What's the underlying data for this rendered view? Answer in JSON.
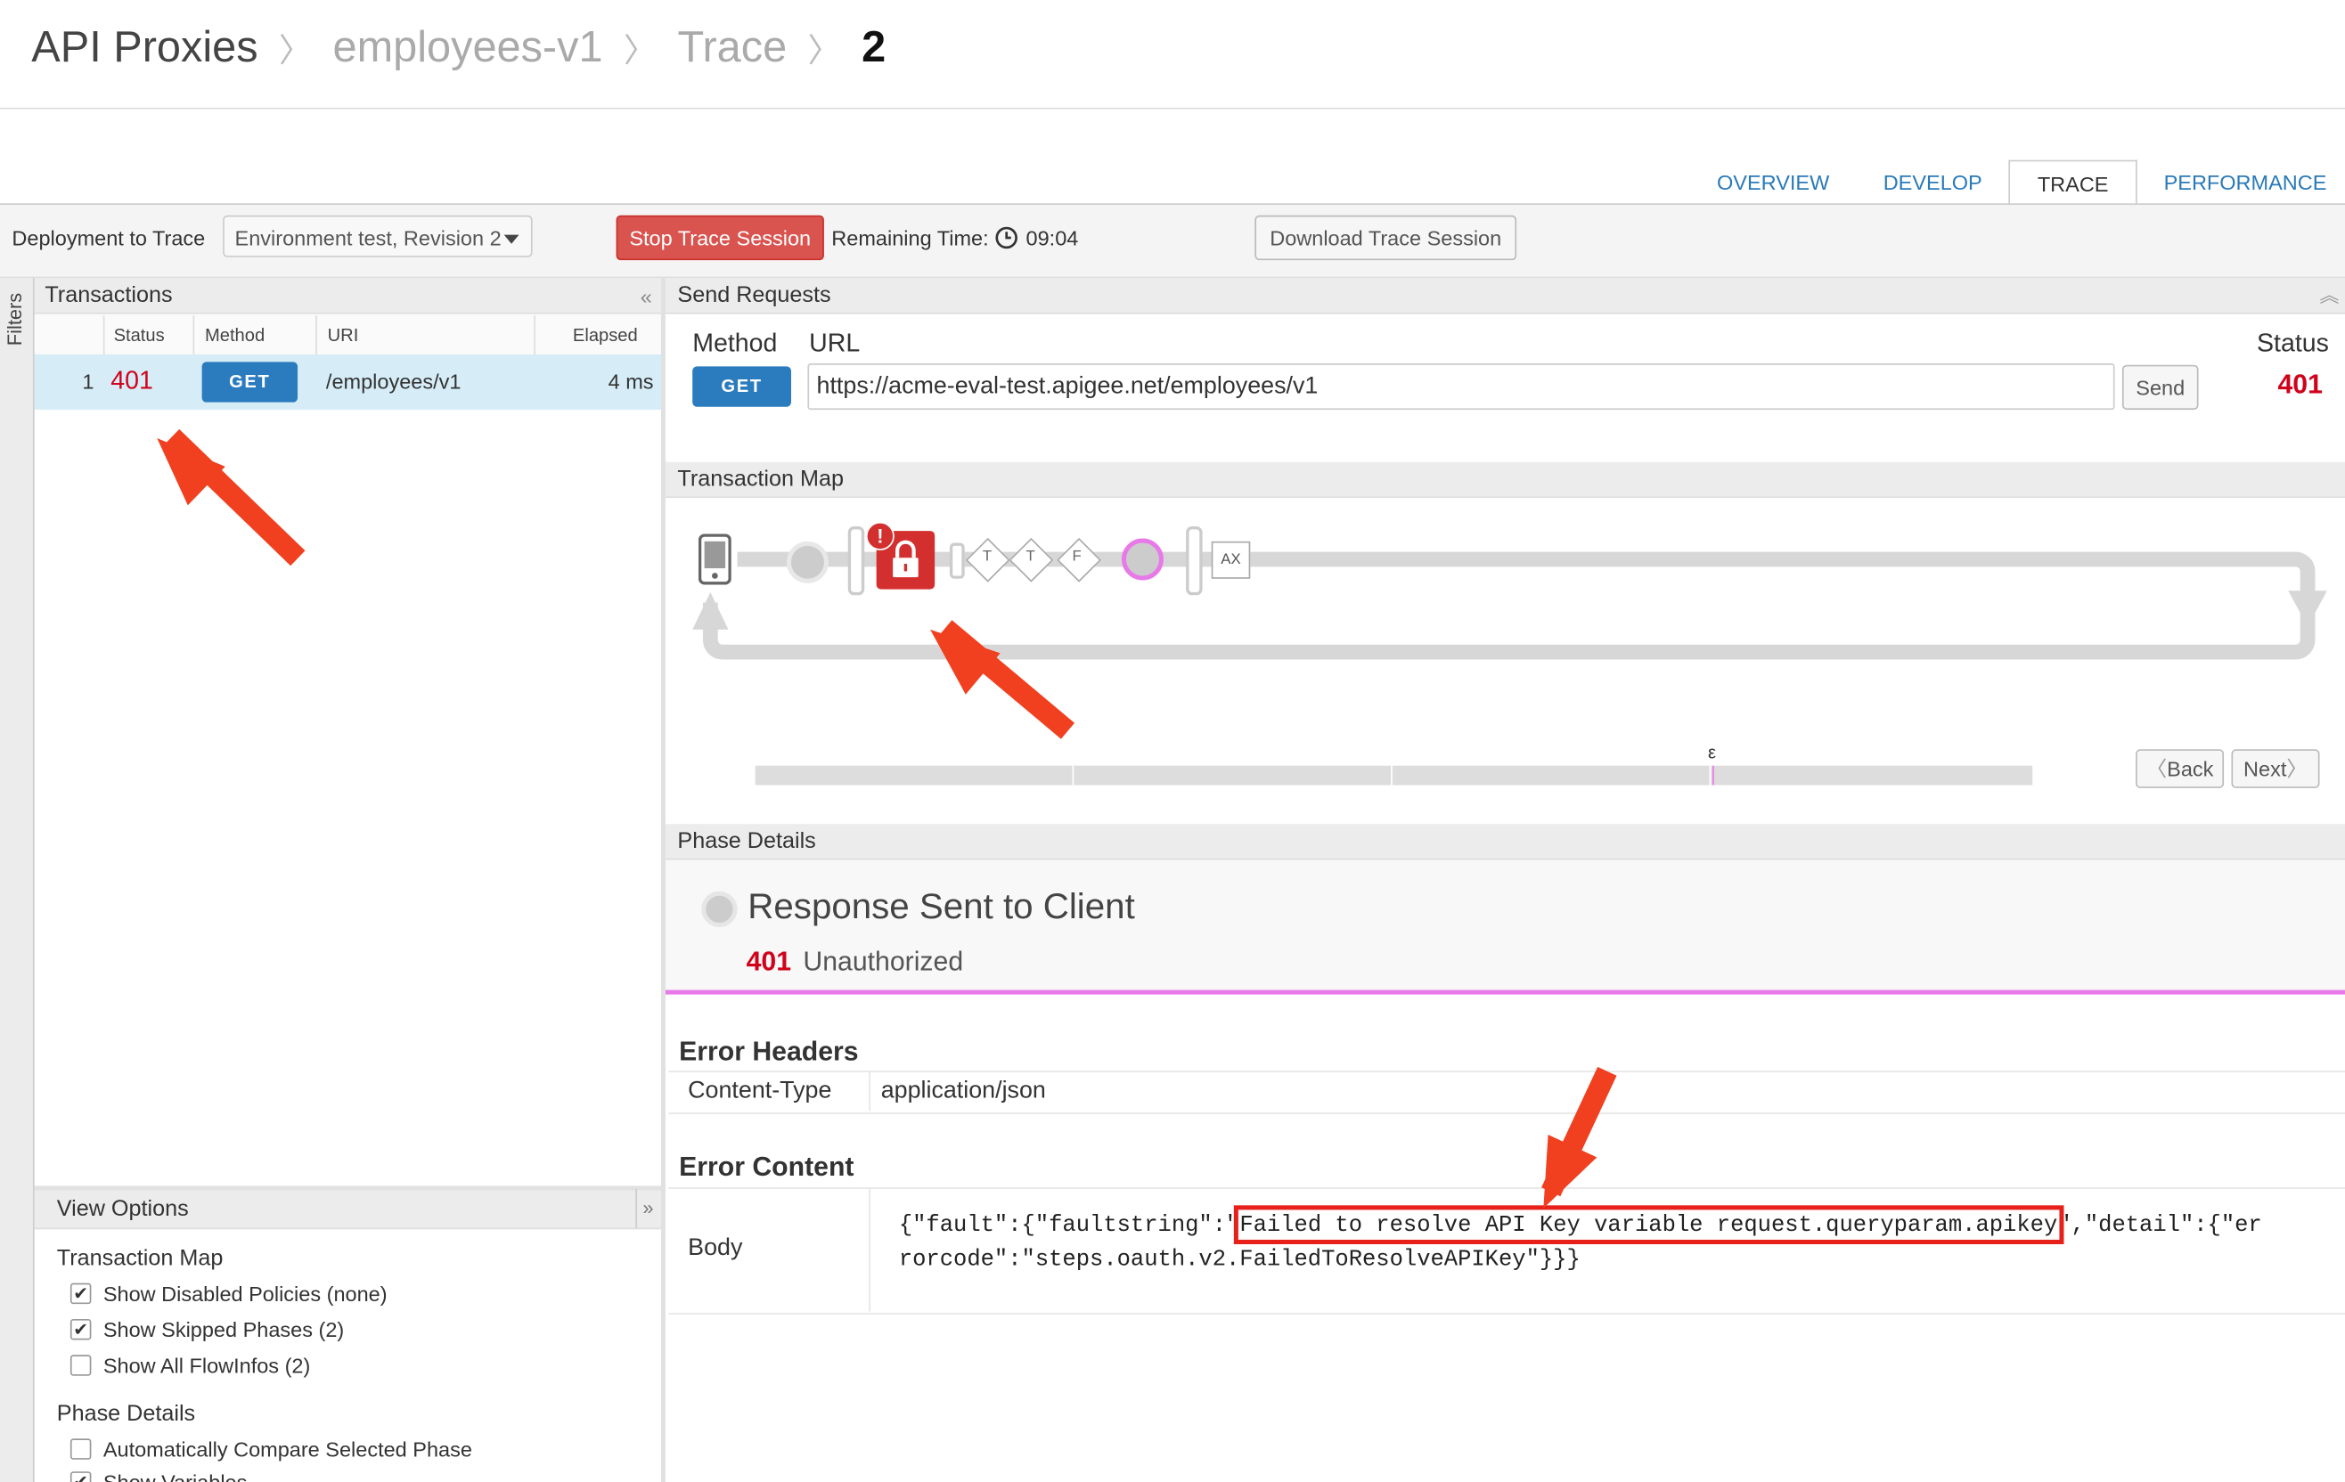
{
  "breadcrumb": {
    "items": [
      "API Proxies",
      "employees-v1",
      "Trace"
    ],
    "current": "2"
  },
  "tabs": [
    "OVERVIEW",
    "DEVELOP",
    "TRACE",
    "PERFORMANCE"
  ],
  "active_tab": "TRACE",
  "toolbar": {
    "deploy_label": "Deployment to Trace",
    "deploy_value": "Environment test, Revision 2",
    "stop_button": "Stop Trace Session",
    "remaining_label": "Remaining Time:",
    "remaining_value": "09:04",
    "download_button": "Download Trace Session"
  },
  "sidebar": {
    "filters_label": "Filters"
  },
  "transactions": {
    "title": "Transactions",
    "columns": [
      "Status",
      "Method",
      "URI",
      "Elapsed"
    ],
    "rows": [
      {
        "index": "1",
        "status": "401",
        "method": "GET",
        "uri": "/employees/v1",
        "elapsed": "4 ms"
      }
    ]
  },
  "view_options": {
    "title": "View Options",
    "transaction_map_title": "Transaction Map",
    "options": [
      {
        "label": "Show Disabled Policies (none)",
        "checked": true
      },
      {
        "label": "Show Skipped Phases (2)",
        "checked": true
      },
      {
        "label": "Show All FlowInfos (2)",
        "checked": false
      }
    ],
    "phase_details_title": "Phase Details",
    "phase_options": [
      {
        "label": "Automatically Compare Selected Phase",
        "checked": false
      },
      {
        "label": "Show Variables",
        "checked": true
      }
    ]
  },
  "send_requests": {
    "title": "Send Requests",
    "method_label": "Method",
    "url_label": "URL",
    "status_label": "Status",
    "method": "GET",
    "url": "https://acme-eval-test.apigee.net/employees/v1",
    "send_button": "Send",
    "status": "401"
  },
  "transaction_map": {
    "title": "Transaction Map",
    "nodes": [
      "T",
      "T",
      "F",
      "AX"
    ],
    "epsilon": "ε",
    "back_button": "Back",
    "next_button": "Next"
  },
  "phase_details": {
    "title": "Phase Details",
    "phase_name": "Response Sent to Client",
    "status_code": "401",
    "status_text": "Unauthorized"
  },
  "error_headers": {
    "title": "Error Headers",
    "rows": [
      {
        "name": "Content-Type",
        "value": "application/json"
      }
    ]
  },
  "error_content": {
    "title": "Error Content",
    "row_label": "Body",
    "body_prefix": "{\"fault\":{\"faultstring\":\"",
    "body_highlight": "Failed to resolve API Key variable request.queryparam.apikey",
    "body_mid": "\",\"detail\":{\"er",
    "body_line2": "rorcode\":\"steps.oauth.v2.FailedToResolveAPIKey\"}}}"
  },
  "colors": {
    "accent_blue": "#2b7bbf",
    "error_red": "#d0021b",
    "stop_red": "#d9534f",
    "annotation_red": "#f0401f",
    "phase_pink": "#e879e8",
    "selected_row": "#d6edf7"
  }
}
